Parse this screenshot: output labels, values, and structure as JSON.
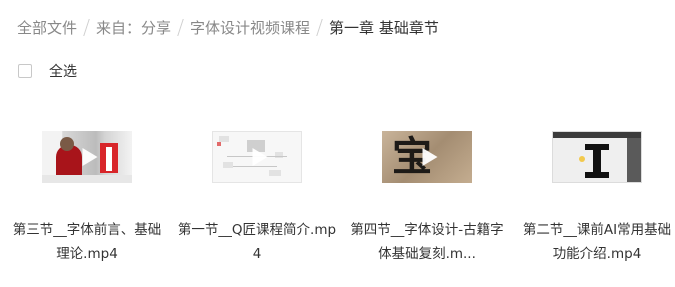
{
  "breadcrumb": {
    "items": [
      "全部文件",
      "来自：分享",
      "字体设计视频课程",
      "第一章 基础章节"
    ]
  },
  "select_all": {
    "label": "全选"
  },
  "files": [
    {
      "name": "第三节__字体前言、基础理论.mp4",
      "icon": "video-thumbnail"
    },
    {
      "name": "第一节__Q匠课程简介.mp4",
      "icon": "video-thumbnail"
    },
    {
      "name": "第四节__字体设计-古籍字体基础复刻.m...",
      "icon": "video-thumbnail"
    },
    {
      "name": "第二节__课前AI常用基础功能介绍.mp4",
      "icon": "video-thumbnail"
    }
  ],
  "thumb_text": {
    "glyph": "宝"
  },
  "colors": {
    "text": "#333333",
    "muted": "#888888",
    "separator": "#cfcfcf"
  }
}
